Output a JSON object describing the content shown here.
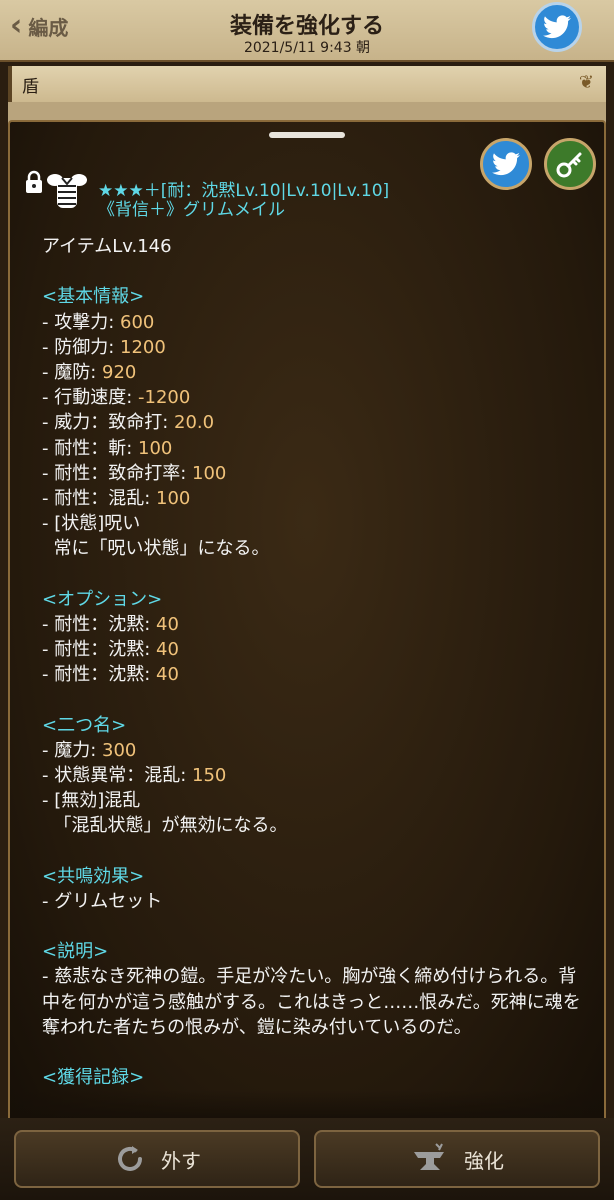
{
  "header": {
    "back_label": "編成",
    "title": "装備を強化する",
    "subtitle": "2021/5/11 9:43 朝"
  },
  "behind": {
    "category": "盾"
  },
  "item": {
    "line1": "★★★＋[耐：沈黙Lv.10|Lv.10|Lv.10]",
    "line2": "《背信＋》グリムメイル"
  },
  "details": {
    "level": "アイテムLv.146",
    "basic_header": "<基本情報>",
    "basic": [
      {
        "label": "- 攻撃力: ",
        "value": "600"
      },
      {
        "label": "- 防御力: ",
        "value": "1200"
      },
      {
        "label": "- 魔防: ",
        "value": "920"
      },
      {
        "label": "- 行動速度: ",
        "value": "-1200"
      },
      {
        "label": "- 威力：致命打: ",
        "value": "20.0"
      },
      {
        "label": "- 耐性：斬: ",
        "value": "100"
      },
      {
        "label": "- 耐性：致命打率: ",
        "value": "100"
      },
      {
        "label": "- 耐性：混乱: ",
        "value": "100"
      }
    ],
    "basic_effect_name": "- [状態]呪い",
    "basic_effect_desc": "  常に「呪い状態」になる。",
    "option_header": "<オプション>",
    "options": [
      {
        "label": "- 耐性：沈黙: ",
        "value": "40"
      },
      {
        "label": "- 耐性：沈黙: ",
        "value": "40"
      },
      {
        "label": "- 耐性：沈黙: ",
        "value": "40"
      }
    ],
    "alias_header": "<二つ名>",
    "alias": [
      {
        "label": "- 魔力: ",
        "value": "300"
      },
      {
        "label": "- 状態異常：混乱: ",
        "value": "150"
      }
    ],
    "alias_effect_name": "- [無効]混乱",
    "alias_effect_desc": "  「混乱状態」が無効になる。",
    "resonance_header": "<共鳴効果>",
    "resonance": "- グリムセット",
    "desc_header": "<説明>",
    "desc": "- 慈悲なき死神の鎧。手足が冷たい。胸が強く締め付けられる。背中を何かが這う感触がする。これはきっと……恨みだ。死神に魂を奪われた者たちの恨みが、鎧に染み付いているのだ。",
    "record_header": "<獲得記録>"
  },
  "buttons": {
    "remove": "外す",
    "enhance": "強化"
  }
}
